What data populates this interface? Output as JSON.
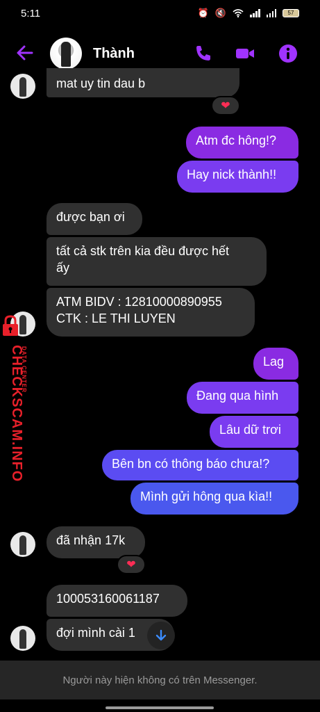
{
  "status_bar": {
    "time": "5:11",
    "battery": "57"
  },
  "header": {
    "contact_name": "Thành"
  },
  "messages": [
    {
      "side": "in",
      "text": "mat uy tin dau b"
    },
    {
      "side": "out",
      "text": "Atm đc hông!?"
    },
    {
      "side": "out",
      "text": "Hay nick thành!!"
    },
    {
      "side": "in",
      "text": "được bạn ơi"
    },
    {
      "side": "in",
      "text": "tất cả stk trên kia đều được hết\nấy"
    },
    {
      "side": "in",
      "text": "ATM BIDV : 12810000890955\nCTK : LE THI LUYEN"
    },
    {
      "side": "out",
      "text": "Lag"
    },
    {
      "side": "out",
      "text": "Đang qua hình"
    },
    {
      "side": "out",
      "text": "Lâu dữ trơi"
    },
    {
      "side": "out",
      "text": "Bên bn có thông báo chưa!?"
    },
    {
      "side": "out",
      "text": "Mình gửi hông qua kìa!!"
    },
    {
      "side": "in",
      "text": "đã nhận 17k"
    },
    {
      "side": "in",
      "text": "100053160061187"
    },
    {
      "side": "in",
      "text": "đợi mình cài 1"
    }
  ],
  "reactions": [
    "❤",
    "❤"
  ],
  "watermark": {
    "title": "CHECKSCAM.INFO",
    "subtitle": "DATA CENTER"
  },
  "footer": {
    "notice": "Người này hiện không có trên Messenger."
  },
  "colors": {
    "accent": "#a033ff",
    "outgoing": "#8a2be2",
    "incoming": "#303030",
    "heart": "#ff2d55"
  }
}
